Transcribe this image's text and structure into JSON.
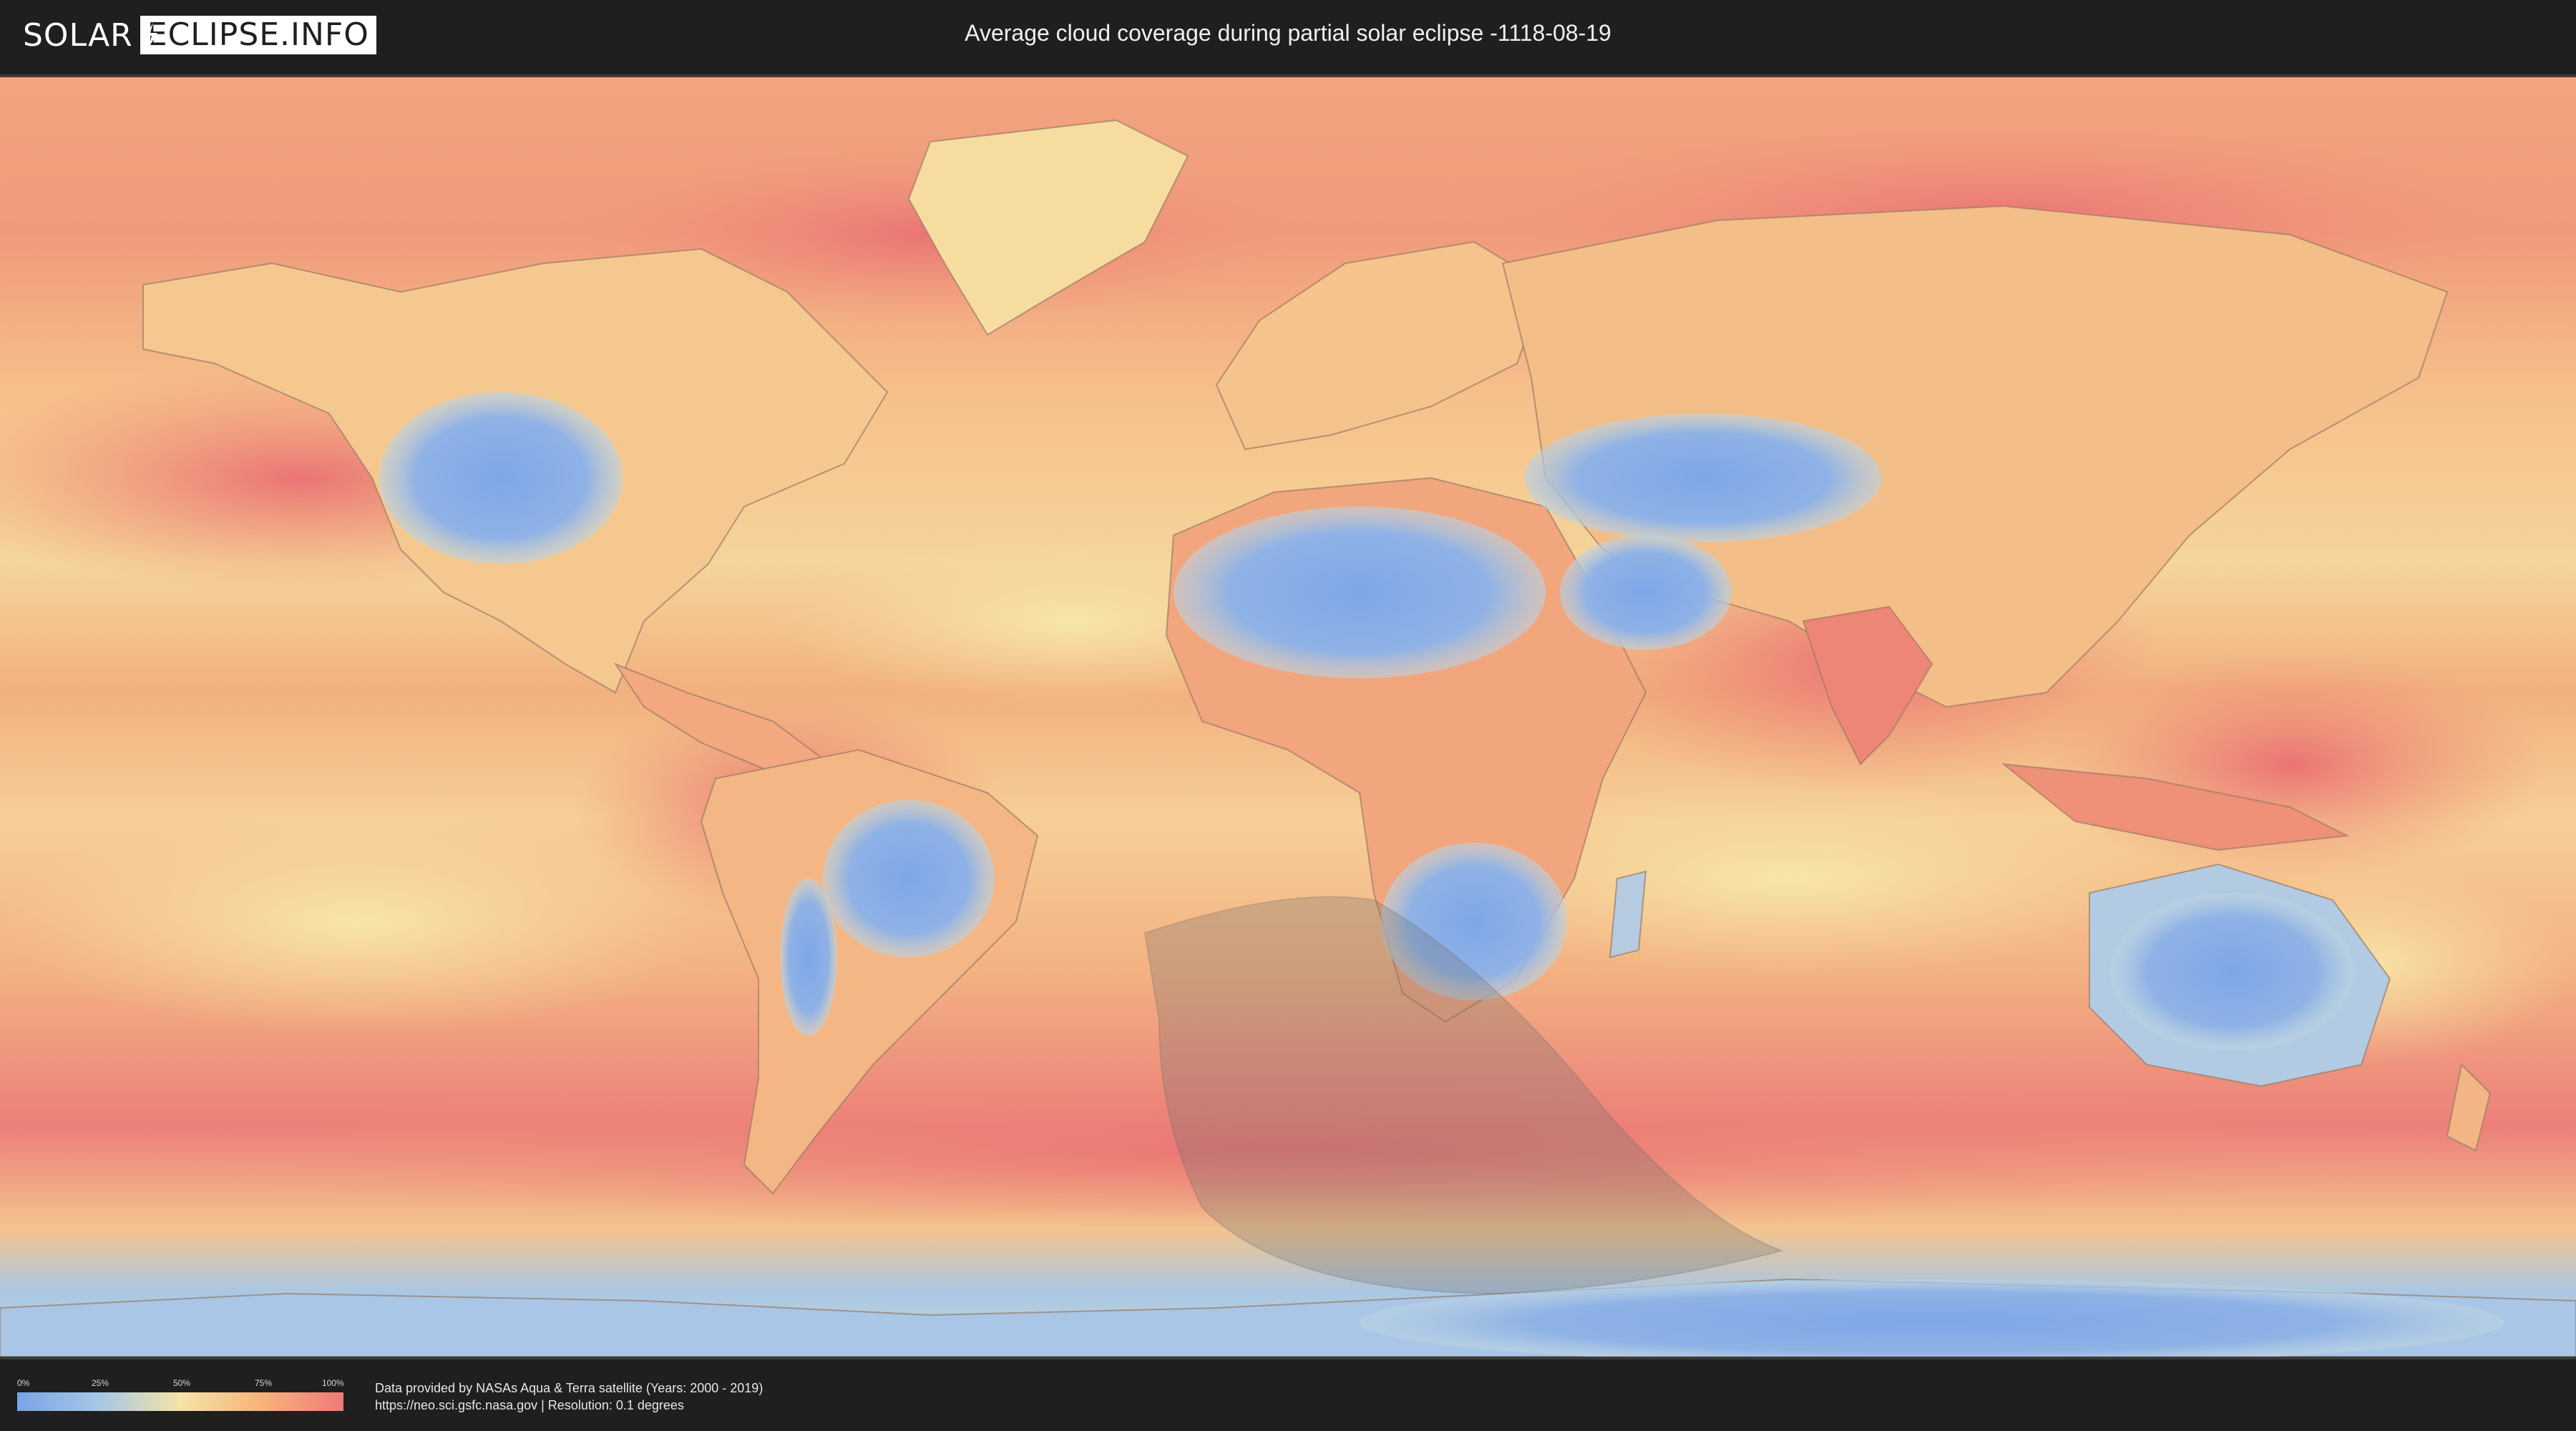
{
  "header": {
    "logo_left": "SOLAR",
    "logo_right": "ECLIPSE.INFO",
    "title": "Average cloud coverage during partial solar eclipse -1118-08-19"
  },
  "map": {
    "kind": "world cloud coverage map (equirectangular)",
    "overlay": "partial eclipse visibility region (shaded)",
    "colors": {
      "low": "#7aa3e8",
      "mid_low": "#a6c7e6",
      "mid": "#f6e3a6",
      "mid_high": "#f6b37a",
      "high": "#ef7a7a",
      "overlay": "#6b6b6b"
    }
  },
  "legend": {
    "ticks": [
      "0%",
      "25%",
      "50%",
      "75%",
      "100%"
    ],
    "tick_values": [
      0,
      25,
      50,
      75,
      100
    ]
  },
  "footer": {
    "line1": "Data provided by NASAs Aqua & Terra satellite (Years: 2000 - 2019)",
    "line2": "https://neo.sci.gsfc.nasa.gov | Resolution: 0.1 degrees"
  }
}
